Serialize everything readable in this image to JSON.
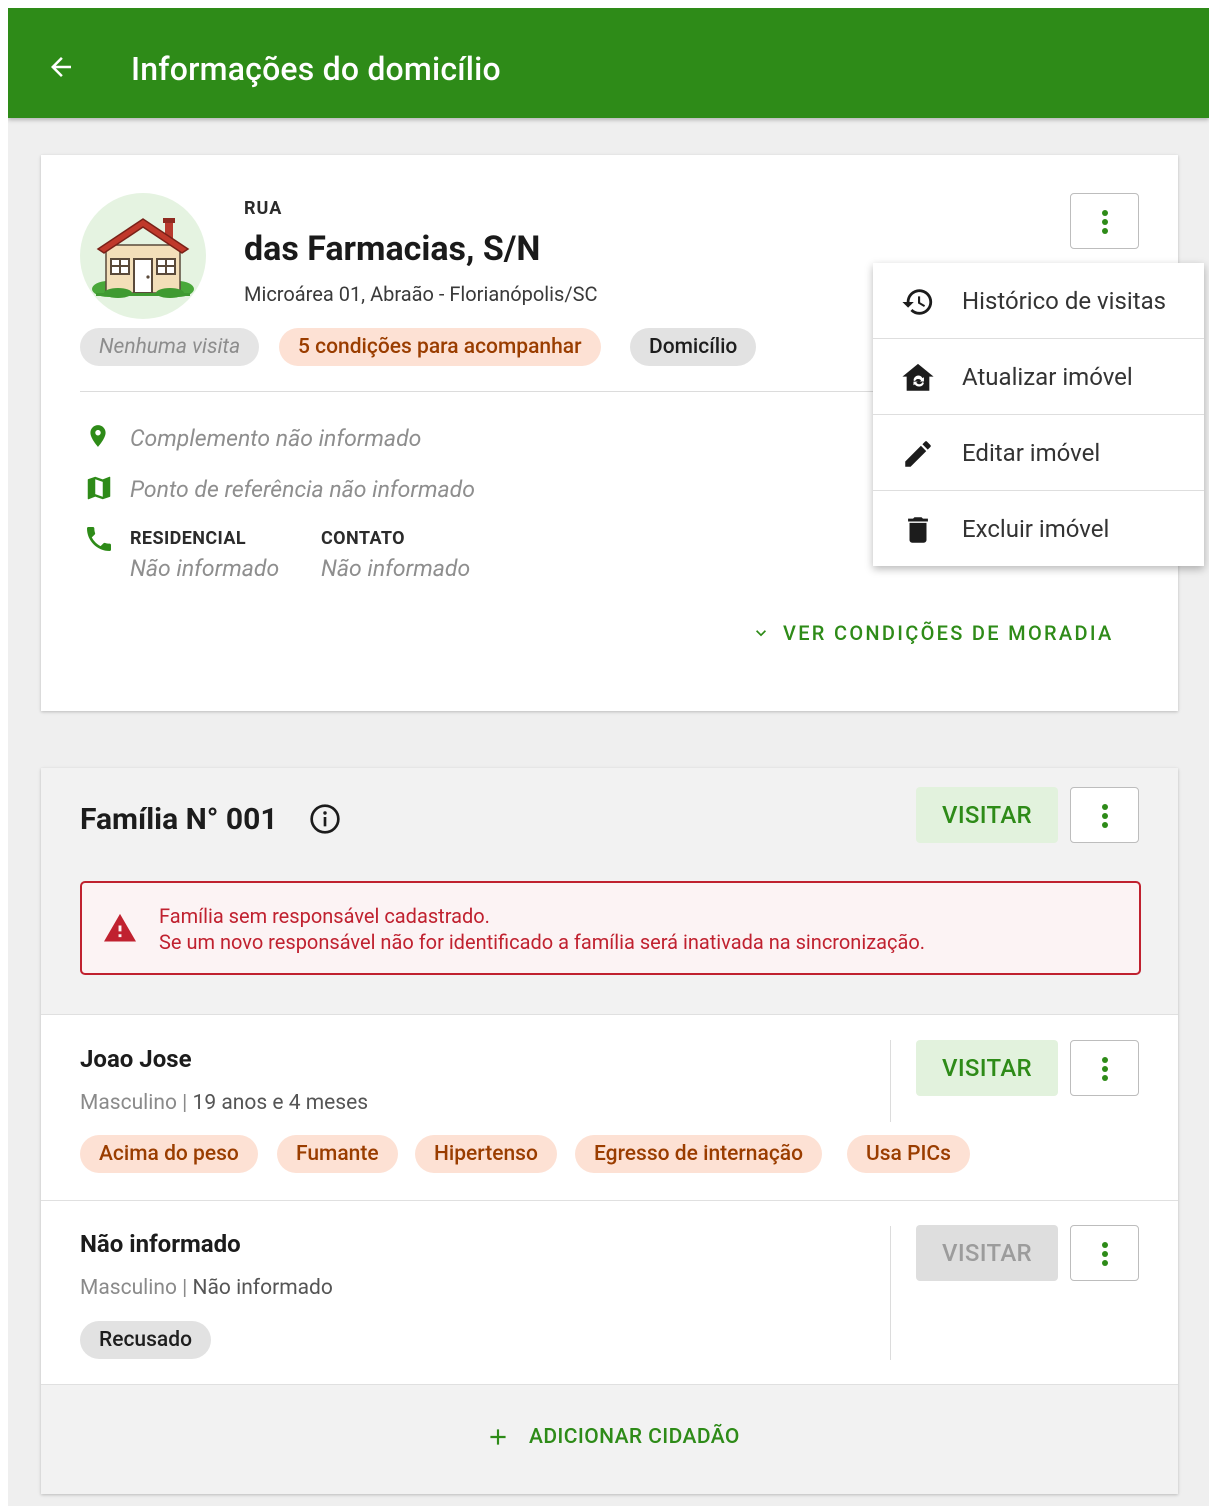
{
  "appbar": {
    "title": "Informações do domicílio",
    "back_icon": "arrow-left-icon",
    "color": "#2e8b18"
  },
  "address": {
    "street_type": "RUA",
    "street_name": "das Farmacias, S/N",
    "subtitle": "Microárea 01, Abraão - Florianópolis/SC",
    "chips": [
      {
        "label": "Nenhuma visita",
        "style": "grey-italic"
      },
      {
        "label": "5 condições para acompanhar",
        "style": "orange"
      },
      {
        "label": "Domicílio",
        "style": "grey"
      }
    ],
    "complemento": "Complemento não informado",
    "referencia": "Ponto de referência não informado",
    "phone": {
      "residencial_label": "RESIDENCIAL",
      "residencial_value": "Não informado",
      "contato_label": "CONTATO",
      "contato_value": "Não informado"
    },
    "ver_condicoes": "VER CONDIÇÕES DE MORADIA"
  },
  "menu": {
    "items": [
      {
        "label": "Histórico de visitas",
        "icon": "history-icon"
      },
      {
        "label": "Atualizar imóvel",
        "icon": "house-sync-icon"
      },
      {
        "label": "Editar imóvel",
        "icon": "pencil-icon"
      },
      {
        "label": "Excluir imóvel",
        "icon": "trash-icon"
      }
    ]
  },
  "family": {
    "title": "Família N° 001",
    "visit_label": "VISITAR",
    "alert": {
      "line1": "Família sem responsável cadastrado.",
      "line2": "Se um novo responsável não for identificado a família será inativada na sincronização."
    },
    "members": [
      {
        "name": "Joao Jose",
        "sex": "Masculino",
        "age": "19 anos e 4 meses",
        "visit_label": "VISITAR",
        "visit_enabled": true,
        "tags": [
          "Acima do peso",
          "Fumante",
          "Hipertenso",
          "Egresso de internação",
          "Usa PICs"
        ]
      },
      {
        "name": "Não informado",
        "sex": "Masculino",
        "age": "Não informado",
        "visit_label": "VISITAR",
        "visit_enabled": false,
        "tags": [
          "Recusado"
        ]
      }
    ],
    "add_label": "ADICIONAR CIDADÃO"
  },
  "colors": {
    "primary": "#2e8b18",
    "alert": "#c0212f",
    "chip_orange_bg": "#fde1d4",
    "chip_orange_text": "#9a3d00"
  }
}
